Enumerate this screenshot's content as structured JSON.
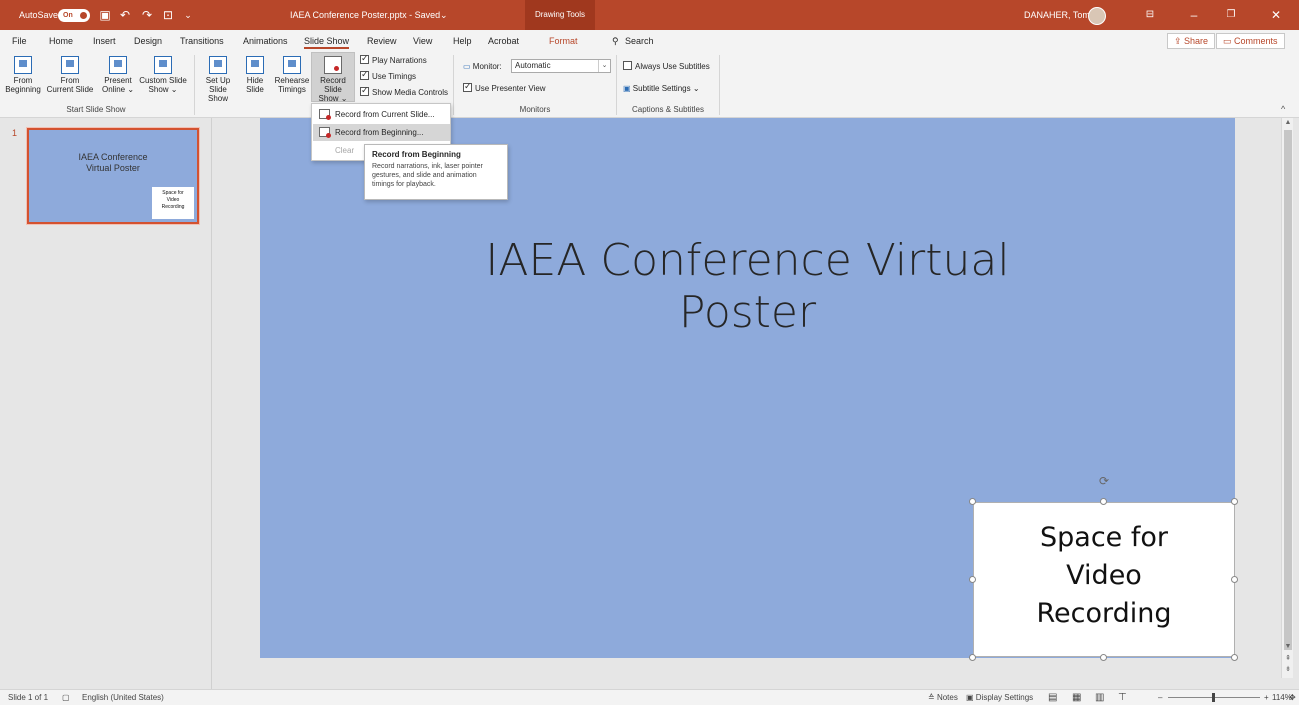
{
  "titlebar": {
    "autosave_label": "AutoSave",
    "autosave_state": "On",
    "document_title": "IAEA Conference Poster.pptx - Saved",
    "title_caret": "⌄",
    "context_tab": "Drawing Tools",
    "user_name": "DANAHER, Tom",
    "accent_color": "#b7472a"
  },
  "tabs": [
    "File",
    "Home",
    "Insert",
    "Design",
    "Transitions",
    "Animations",
    "Slide Show",
    "Review",
    "View",
    "Help",
    "Acrobat",
    "Format"
  ],
  "active_tab": "Slide Show",
  "search_label": "Search",
  "share_label": "Share",
  "comments_label": "Comments",
  "ribbon": {
    "start": {
      "from_beginning": [
        "From",
        "Beginning"
      ],
      "from_current": [
        "From",
        "Current Slide"
      ],
      "present_online": [
        "Present",
        "Online ⌄"
      ],
      "custom_show": [
        "Custom Slide",
        "Show ⌄"
      ],
      "group_label": "Start Slide Show"
    },
    "setup": {
      "setup_show": [
        "Set Up",
        "Slide Show"
      ],
      "hide_slide": [
        "Hide",
        "Slide"
      ],
      "rehearse": [
        "Rehearse",
        "Timings"
      ],
      "record": [
        "Record Slide",
        "Show ⌄"
      ],
      "play_narrations": "Play Narrations",
      "use_timings": "Use Timings",
      "show_media": "Show Media Controls"
    },
    "monitors": {
      "monitor_label": "Monitor:",
      "monitor_value": "Automatic",
      "presenter_view": "Use Presenter View",
      "group_label": "Monitors"
    },
    "captions": {
      "always_subtitles": "Always Use Subtitles",
      "subtitle_settings": "Subtitle Settings ⌄",
      "group_label": "Captions & Subtitles"
    }
  },
  "record_menu": {
    "items": [
      "Record from Current Slide...",
      "Record from Beginning...",
      "Clear"
    ],
    "hovered": "Record from Beginning..."
  },
  "tooltip": {
    "title": "Record from Beginning",
    "body": "Record narrations, ink, laser pointer gestures, and slide and animation timings for playback."
  },
  "thumbnail": {
    "number": "1",
    "title": "IAEA Conference Virtual Poster",
    "box_text": [
      "Space for",
      "Video",
      "Recording"
    ]
  },
  "slide": {
    "title_lines": [
      "IAEA Conference Virtual",
      "Poster"
    ],
    "box_lines": [
      "Space for",
      "Video",
      "Recording"
    ],
    "background_color": "#8eaadb"
  },
  "statusbar": {
    "slide_info": "Slide 1 of 1",
    "language": "English (United States)",
    "notes": "Notes",
    "display_settings": "Display Settings",
    "zoom": "114%"
  }
}
